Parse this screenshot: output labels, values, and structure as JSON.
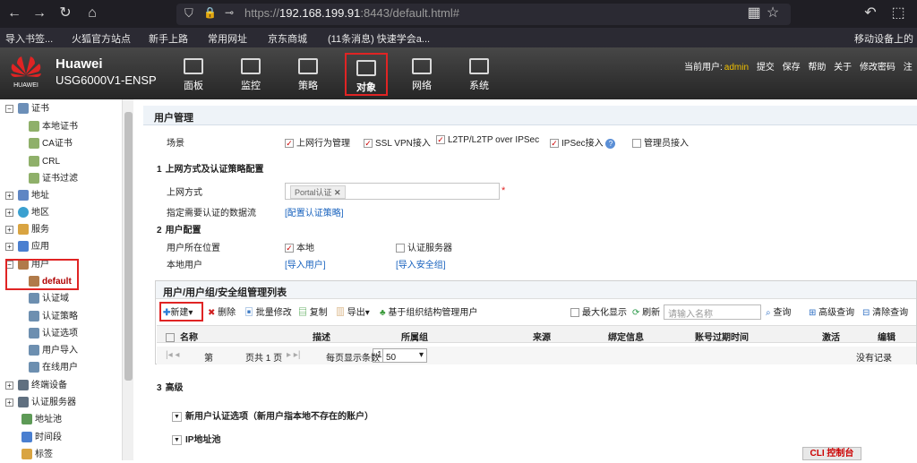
{
  "browser": {
    "url_prefix": "https://",
    "url_host": "192.168.199.91",
    "url_rest": ":8443/default.html#",
    "bookmarks": [
      "导入书签...",
      "火狐官方站点",
      "新手上路",
      "常用网址",
      "京东商城",
      "(11条消息) 快速学会a...",
      "移动设备上的"
    ]
  },
  "header": {
    "brand": "Huawei",
    "logo_text": "HUAWEI",
    "model": "USG6000V1-ENSP",
    "tabs": [
      "面板",
      "监控",
      "策略",
      "对象",
      "网络",
      "系统"
    ],
    "selected_tab": "对象",
    "current_user_label": "当前用户:",
    "current_user": "admin",
    "links": [
      "提交",
      "保存",
      "帮助",
      "关于",
      "修改密码",
      "注"
    ]
  },
  "sidebar": {
    "items": [
      {
        "label": "证书",
        "expand": "−"
      },
      {
        "label": "本地证书"
      },
      {
        "label": "CA证书"
      },
      {
        "label": "CRL"
      },
      {
        "label": "证书过滤"
      },
      {
        "label": "地址",
        "expand": "+"
      },
      {
        "label": "地区",
        "expand": "+"
      },
      {
        "label": "服务",
        "expand": "+"
      },
      {
        "label": "应用",
        "expand": "+"
      },
      {
        "label": "用户",
        "expand": "−"
      },
      {
        "label": "default"
      },
      {
        "label": "认证域"
      },
      {
        "label": "认证策略"
      },
      {
        "label": "认证选项"
      },
      {
        "label": "用户导入"
      },
      {
        "label": "在线用户"
      },
      {
        "label": "终端设备",
        "expand": "+"
      },
      {
        "label": "认证服务器",
        "expand": "+"
      },
      {
        "label": "地址池"
      },
      {
        "label": "时间段"
      },
      {
        "label": "标签"
      }
    ]
  },
  "page": {
    "title": "用户管理",
    "scene_label": "场景",
    "scenes": [
      {
        "label": "上网行为管理",
        "checked": true
      },
      {
        "label": "SSL VPN接入",
        "checked": true
      },
      {
        "label": "L2TP/L2TP over IPSec",
        "checked": true
      },
      {
        "label": "IPSec接入",
        "checked": true
      },
      {
        "label": "管理员接入",
        "checked": false
      }
    ],
    "section1_num": "1",
    "section1": "上网方式及认证策略配置",
    "access_label": "上网方式",
    "access_value": "Portal认证",
    "required_mark": "*",
    "flow_label": "指定需要认证的数据流",
    "flow_link": "[配置认证策略]",
    "section2_num": "2",
    "section2": "用户配置",
    "location_label": "用户所在位置",
    "loc_local": "本地",
    "loc_server": "认证服务器",
    "local_user_label": "本地用户",
    "import_users": "[导入用户]",
    "import_groups": "[导入安全组]",
    "grid": {
      "title": "用户/用户组/安全组管理列表",
      "toolbar": [
        "新建",
        "删除",
        "批量修改",
        "复制",
        "导出",
        "基于组织结构管理用户"
      ],
      "maximize": "最大化显示",
      "refresh": "刷新",
      "search_placeholder": "请输入名称",
      "query": "查询",
      "advanced_query": "高级查询",
      "clear_query": "清除查询",
      "columns": [
        "名称",
        "描述",
        "所属组",
        "来源",
        "绑定信息",
        "账号过期时间",
        "激活",
        "编辑"
      ],
      "pager_page_prefix": "第",
      "pager_page": "1",
      "pager_total": "页共 1 页",
      "per_page_label": "每页显示条数",
      "per_page": "50",
      "no_records": "没有记录"
    },
    "section3_num": "3",
    "section3": "高级",
    "adv1": "新用户认证选项（新用户指本地不存在的账户）",
    "adv2": "IP地址池",
    "cli": "CLI 控制台"
  }
}
